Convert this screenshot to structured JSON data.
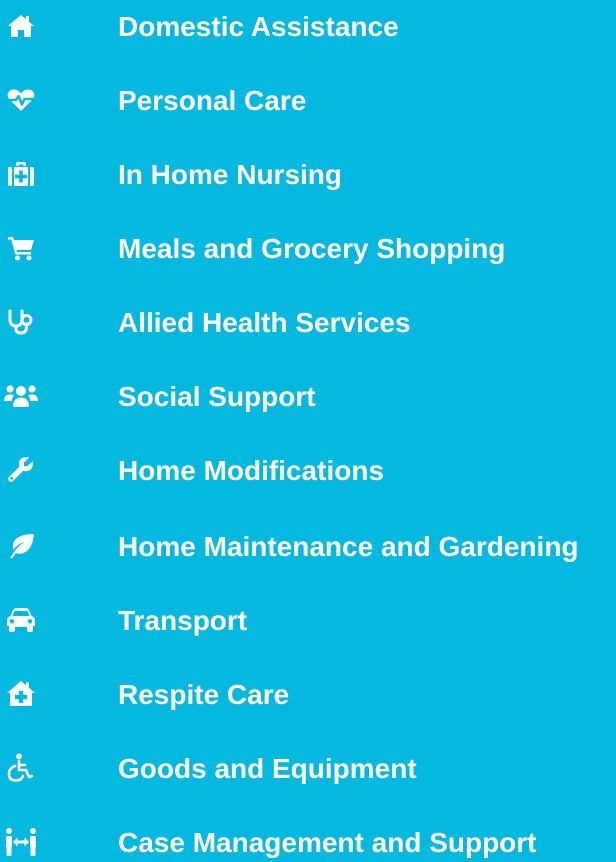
{
  "colors": {
    "background": "#05b8e0",
    "foreground": "#ffffff"
  },
  "services": [
    {
      "label": "Domestic Assistance",
      "icon": "home-icon"
    },
    {
      "label": "Personal Care",
      "icon": "heartbeat-icon"
    },
    {
      "label": "In Home Nursing",
      "icon": "medkit-icon"
    },
    {
      "label": "Meals and Grocery Shopping",
      "icon": "shopping-cart-icon"
    },
    {
      "label": "Allied Health Services",
      "icon": "stethoscope-icon"
    },
    {
      "label": "Social Support",
      "icon": "users-icon"
    },
    {
      "label": "Home Modifications",
      "icon": "wrench-icon"
    },
    {
      "label": "Home Maintenance and Gardening",
      "icon": "leaf-icon"
    },
    {
      "label": "Transport",
      "icon": "car-icon"
    },
    {
      "label": "Respite Care",
      "icon": "clinic-house-icon"
    },
    {
      "label": "Goods and Equipment",
      "icon": "wheelchair-icon"
    },
    {
      "label": "Case Management and Support",
      "icon": "people-arrows-icon"
    }
  ]
}
